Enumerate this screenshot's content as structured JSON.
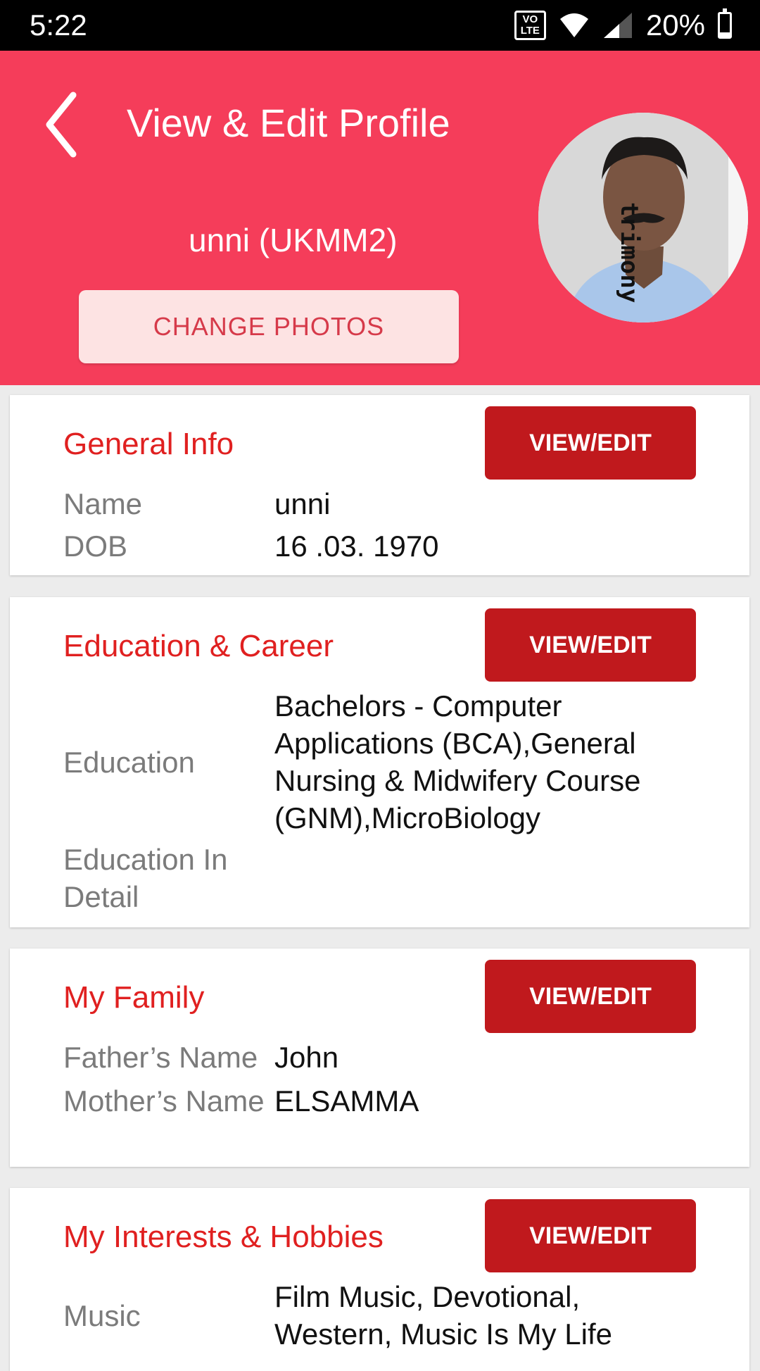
{
  "status_bar": {
    "time": "5:22",
    "volte_top": "VO",
    "volte_bottom": "LTE",
    "battery": "20%"
  },
  "header": {
    "title": "View & Edit Profile",
    "profile_name": "unni (UKMM2)",
    "change_photos_label": "CHANGE PHOTOS",
    "avatar_watermark": "trimony"
  },
  "cards": {
    "general": {
      "title": "General Info",
      "button": "VIEW/EDIT",
      "rows": [
        {
          "label": "Name",
          "value": "unni"
        },
        {
          "label": "DOB",
          "value": "16 .03. 1970"
        }
      ]
    },
    "education": {
      "title": "Education & Career",
      "button": "VIEW/EDIT",
      "rows": [
        {
          "label": "Education",
          "value": "Bachelors - Computer Applications (BCA),General Nursing & Midwifery Course (GNM),MicroBiology"
        },
        {
          "label": "Education In Detail",
          "value": ""
        }
      ]
    },
    "family": {
      "title": "My Family",
      "button": "VIEW/EDIT",
      "rows": [
        {
          "label": "Father’s Name",
          "value": "John"
        },
        {
          "label": "Mother’s Name",
          "value": "ELSAMMA"
        }
      ]
    },
    "interests": {
      "title": "My Interests & Hobbies",
      "button": "VIEW/EDIT",
      "rows": [
        {
          "label": "Music",
          "value": "Film Music, Devotional, Western, Music Is My Life"
        }
      ]
    }
  },
  "colors": {
    "header_bg": "#f53d5a",
    "accent_red": "#e02020",
    "button_red": "#c0191d"
  },
  "icons": {
    "back": "back-arrow-icon",
    "wifi": "wifi-icon",
    "signal": "signal-icon",
    "battery": "battery-icon"
  }
}
